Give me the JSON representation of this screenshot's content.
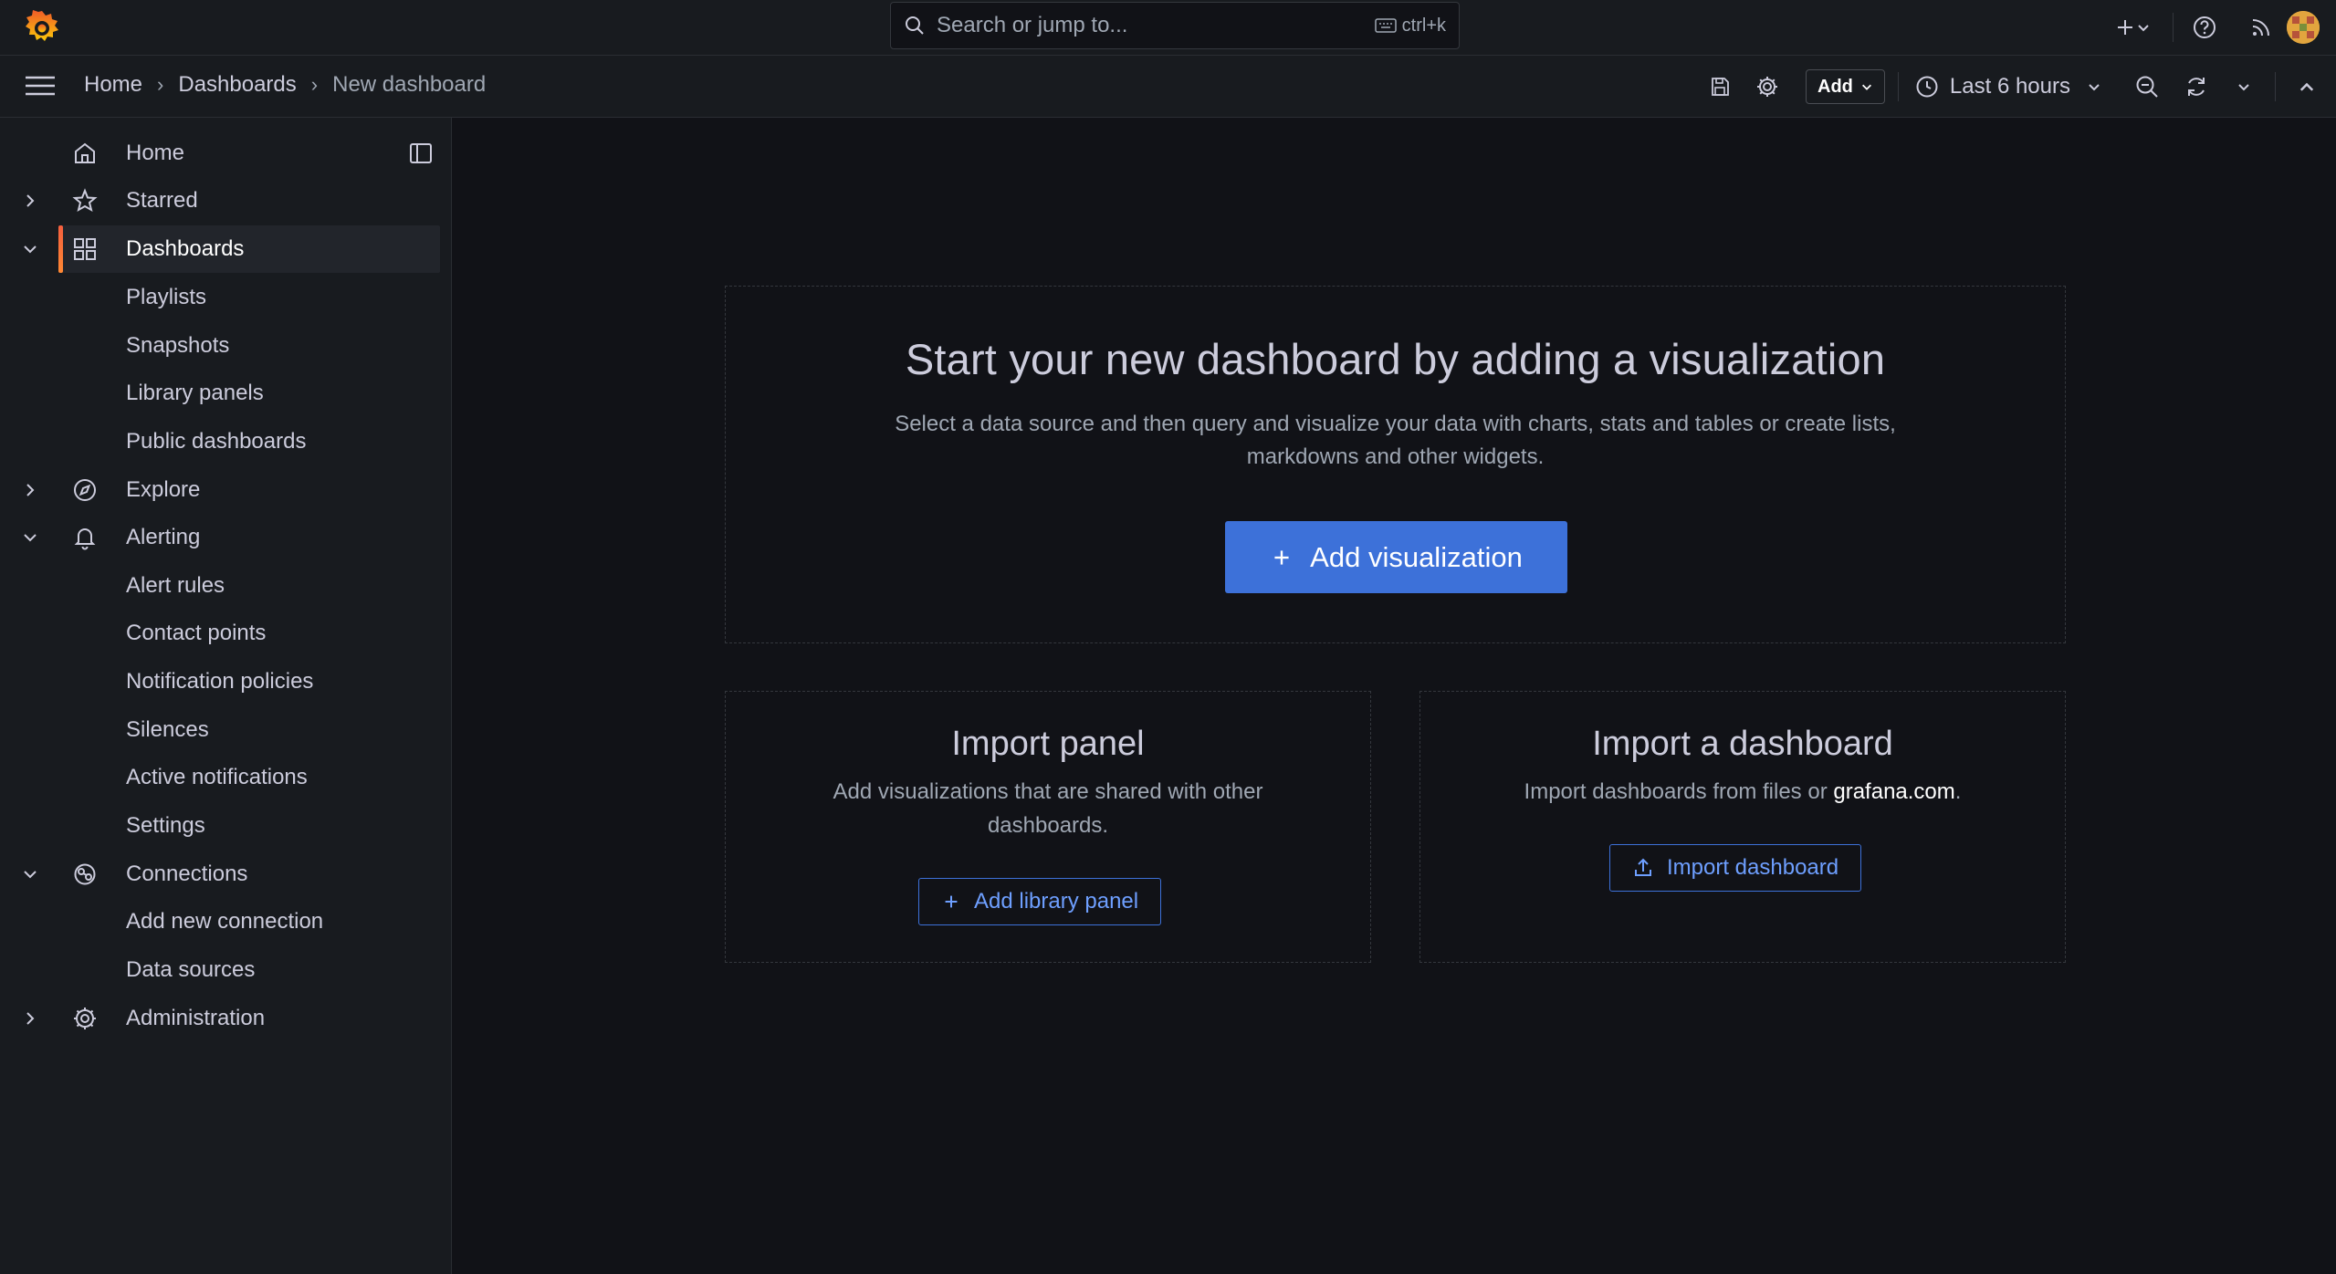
{
  "topbar": {
    "search_placeholder": "Search or jump to...",
    "search_shortcut": "ctrl+k"
  },
  "breadcrumb": {
    "items": [
      "Home",
      "Dashboards",
      "New dashboard"
    ]
  },
  "toolbar": {
    "add_label": "Add",
    "time_range": "Last 6 hours"
  },
  "sidebar": {
    "items": [
      {
        "label": "Home",
        "icon": "home-icon"
      },
      {
        "label": "Starred",
        "icon": "star-icon"
      },
      {
        "label": "Dashboards",
        "icon": "apps-icon"
      },
      {
        "label": "Playlists"
      },
      {
        "label": "Snapshots"
      },
      {
        "label": "Library panels"
      },
      {
        "label": "Public dashboards"
      },
      {
        "label": "Explore",
        "icon": "compass-icon"
      },
      {
        "label": "Alerting",
        "icon": "bell-icon"
      },
      {
        "label": "Alert rules"
      },
      {
        "label": "Contact points"
      },
      {
        "label": "Notification policies"
      },
      {
        "label": "Silences"
      },
      {
        "label": "Active notifications"
      },
      {
        "label": "Settings"
      },
      {
        "label": "Connections",
        "icon": "connections-icon"
      },
      {
        "label": "Add new connection"
      },
      {
        "label": "Data sources"
      },
      {
        "label": "Administration",
        "icon": "cog-icon"
      }
    ]
  },
  "main": {
    "hero_title": "Start your new dashboard by adding a visualization",
    "hero_desc": "Select a data source and then query and visualize your data with charts, stats and tables or create lists, markdowns and other widgets.",
    "add_viz_label": "Add visualization",
    "import_panel_title": "Import panel",
    "import_panel_desc": "Add visualizations that are shared with other dashboards.",
    "add_library_label": "Add library panel",
    "import_dash_title": "Import a dashboard",
    "import_dash_desc_prefix": "Import dashboards from files or ",
    "import_dash_link": "grafana.com",
    "import_dash_desc_suffix": ".",
    "import_dash_label": "Import dashboard"
  },
  "colors": {
    "primary": "#3d71d9",
    "active_accent": "#ff8833",
    "background": "#111217",
    "panel": "#181b1f"
  }
}
